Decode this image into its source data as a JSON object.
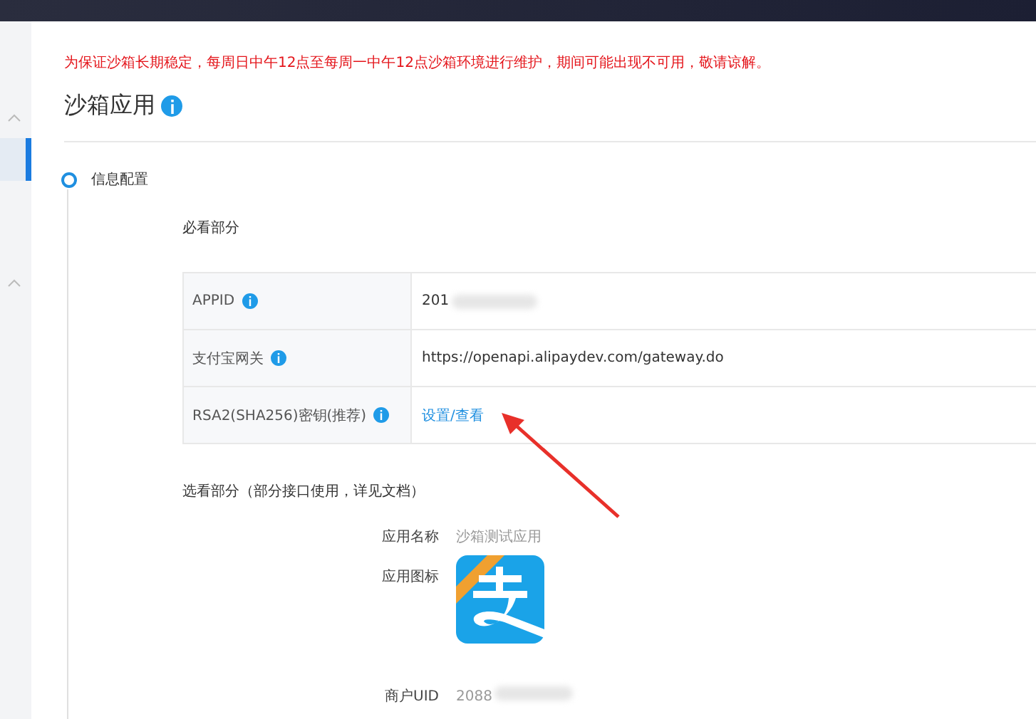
{
  "notice": "为保证沙箱长期稳定，每周日中午12点至每周一中午12点沙箱环境进行维护，期间可能出现不可用，敬请谅解。",
  "page_title": "沙箱应用",
  "step": {
    "label": "信息配置"
  },
  "required_section": {
    "title": "必看部分",
    "rows": [
      {
        "label": "APPID",
        "value": "201",
        "kind": "redacted"
      },
      {
        "label": "支付宝网关",
        "value": "https://openapi.alipaydev.com/gateway.do",
        "kind": "text"
      },
      {
        "label": "RSA2(SHA256)密钥(推荐)",
        "value": "设置/查看",
        "kind": "link"
      }
    ]
  },
  "optional_section": {
    "title": "选看部分（部分接口使用，详见文档）",
    "rows": [
      {
        "label": "应用名称",
        "value": "沙箱测试应用",
        "kind": "text"
      },
      {
        "label": "应用图标",
        "kind": "logo"
      },
      {
        "label": "商户UID",
        "value": "2088",
        "kind": "redacted"
      }
    ]
  }
}
